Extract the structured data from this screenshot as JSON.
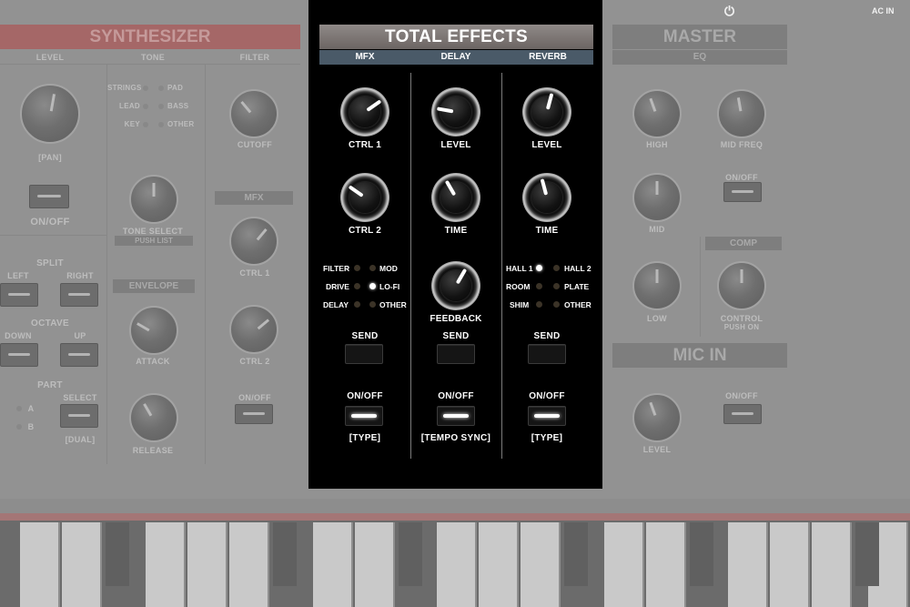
{
  "background": {
    "power_label": "AC IN",
    "synthesizer": {
      "title": "SYNTHESIZER",
      "level_label": "LEVEL",
      "pan_label": "[PAN]",
      "tone_label": "TONE",
      "filter_label": "FILTER",
      "tone_options": [
        "STRINGS",
        "PAD",
        "LEAD",
        "BASS",
        "KEY",
        "OTHER"
      ],
      "cutoff_label": "CUTOFF",
      "onoff_label": "ON/OFF",
      "tone_select_label": "TONE SELECT",
      "push_list_label": "PUSH LIST",
      "mfx_label": "MFX",
      "ctrl1_label": "CTRL 1",
      "ctrl2_label": "CTRL 2",
      "split_label": "SPLIT",
      "left_label": "LEFT",
      "right_label": "RIGHT",
      "envelope_label": "ENVELOPE",
      "octave_label": "OCTAVE",
      "down_label": "DOWN",
      "up_label": "UP",
      "attack_label": "ATTACK",
      "part_label": "PART",
      "part_a": "A",
      "part_b": "B",
      "select_label": "SELECT",
      "dual_label": "[DUAL]",
      "release_label": "RELEASE",
      "filter_onoff_label": "ON/OFF"
    },
    "master": {
      "title": "MASTER",
      "eq_label": "EQ",
      "high_label": "HIGH",
      "mid_freq_label": "MID FREQ",
      "onoff_label": "ON/OFF",
      "mid_label": "MID",
      "comp_label": "COMP",
      "low_label": "LOW",
      "control_label": "CONTROL",
      "push_on_label": "PUSH ON"
    },
    "mic_in": {
      "title": "MIC IN",
      "onoff_label": "ON/OFF",
      "level_label": "LEVEL"
    }
  },
  "total_effects": {
    "title": "TOTAL EFFECTS",
    "sections": [
      "MFX",
      "DELAY",
      "REVERB"
    ],
    "mfx": {
      "knob1_label": "CTRL 1",
      "knob2_label": "CTRL 2",
      "types_left": [
        "FILTER",
        "DRIVE",
        "DELAY"
      ],
      "types_right": [
        "MOD",
        "LO-FI",
        "OTHER"
      ],
      "selected": "LO-FI",
      "send_label": "SEND",
      "onoff_label": "ON/OFF",
      "sub_label": "[TYPE]"
    },
    "delay": {
      "knob1_label": "LEVEL",
      "knob2_label": "TIME",
      "knob3_label": "FEEDBACK",
      "send_label": "SEND",
      "onoff_label": "ON/OFF",
      "sub_label": "[TEMPO SYNC]"
    },
    "reverb": {
      "knob1_label": "LEVEL",
      "knob2_label": "TIME",
      "types_left": [
        "HALL 1",
        "ROOM",
        "SHIM"
      ],
      "types_right": [
        "HALL 2",
        "PLATE",
        "OTHER"
      ],
      "selected": "HALL 1",
      "send_label": "SEND",
      "onoff_label": "ON/OFF",
      "sub_label": "[TYPE]"
    }
  },
  "icons": {
    "power": "power-icon"
  }
}
